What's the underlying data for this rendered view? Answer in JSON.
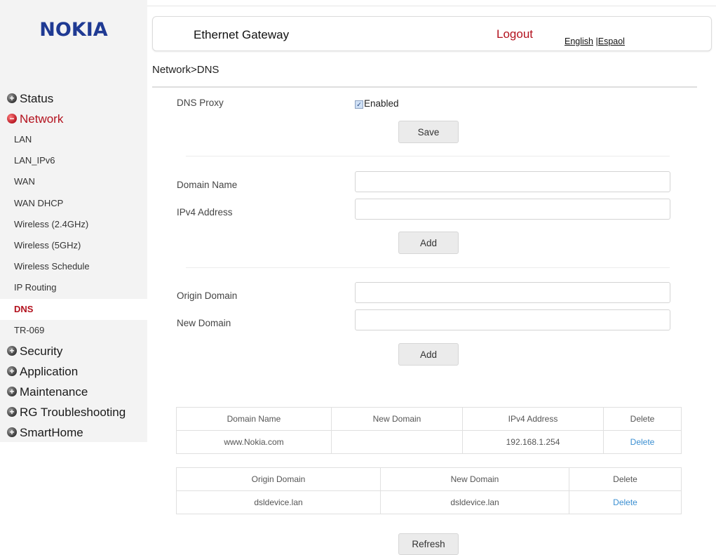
{
  "brand": "NOKIA",
  "header": {
    "title": "Ethernet Gateway",
    "logout": "Logout",
    "lang_english": "English",
    "lang_separator": " |",
    "lang_spanish": "Espaol"
  },
  "breadcrumb": "Network>DNS",
  "sidebar": {
    "categories_top": [
      {
        "label": "Status",
        "state": "collapsed"
      },
      {
        "label": "Network",
        "state": "expanded"
      }
    ],
    "network_items": [
      {
        "label": "LAN"
      },
      {
        "label": "LAN_IPv6"
      },
      {
        "label": "WAN"
      },
      {
        "label": "WAN DHCP"
      },
      {
        "label": "Wireless (2.4GHz)"
      },
      {
        "label": "Wireless (5GHz)"
      },
      {
        "label": "Wireless Schedule"
      },
      {
        "label": "IP Routing"
      },
      {
        "label": "DNS",
        "active": true
      },
      {
        "label": "TR-069"
      }
    ],
    "categories_bottom": [
      {
        "label": "Security"
      },
      {
        "label": "Application"
      },
      {
        "label": "Maintenance"
      },
      {
        "label": "RG Troubleshooting"
      },
      {
        "label": "SmartHome"
      }
    ]
  },
  "proxy": {
    "label": "DNS Proxy",
    "checkbox_label": "Enabled",
    "checked": true,
    "save_label": "Save"
  },
  "host_form": {
    "domain_label": "Domain Name",
    "domain_value": "",
    "ipv4_label": "IPv4 Address",
    "ipv4_value": "",
    "add_label": "Add"
  },
  "rewrite_form": {
    "origin_label": "Origin Domain",
    "origin_value": "",
    "new_label": "New Domain",
    "new_value": "",
    "add_label": "Add"
  },
  "hosts_table": {
    "headers": [
      "Domain Name",
      "New Domain",
      "IPv4 Address",
      "Delete"
    ],
    "rows": [
      {
        "domain": "www.Nokia.com",
        "new_domain": "",
        "ipv4": "192.168.1.254",
        "action": "Delete"
      }
    ]
  },
  "rewrite_table": {
    "headers": [
      "Origin Domain",
      "New Domain",
      "Delete"
    ],
    "rows": [
      {
        "origin": "dsldevice.lan",
        "new_domain": "dsldevice.lan",
        "action": "Delete"
      }
    ]
  },
  "refresh_label": "Refresh",
  "colors": {
    "brand_blue": "#1f3a93",
    "accent_red": "#b3121e",
    "link_blue": "#3b8fd1"
  }
}
